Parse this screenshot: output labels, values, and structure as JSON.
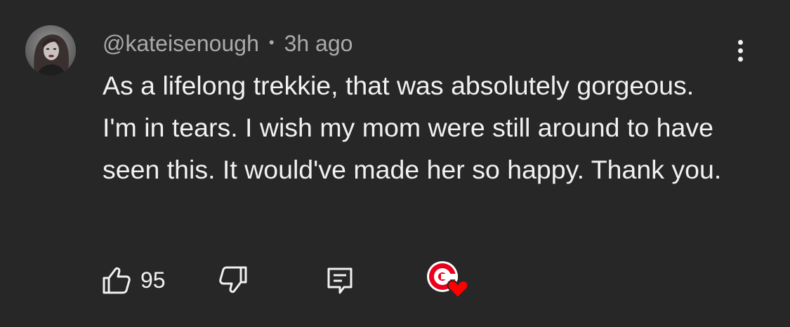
{
  "comment": {
    "author": "@kateisenough",
    "separator": "•",
    "timestamp": "3h ago",
    "text": "As a lifelong trekkie, that was absolutely gorgeous. I'm in tears. I wish my mom were still around to have seen this. It would've made her so happy. Thank you.",
    "like_count": "95"
  },
  "icons": {
    "like": "thumbs-up-icon",
    "dislike": "thumbs-down-icon",
    "reply": "reply-comment-icon",
    "creator_heart": "creator-heart-icon",
    "more": "more-vertical-icon"
  },
  "colors": {
    "background": "#272727",
    "primary_text": "#f1f1f1",
    "secondary_text": "#aaaaaa",
    "heart_red": "#ff0000"
  }
}
